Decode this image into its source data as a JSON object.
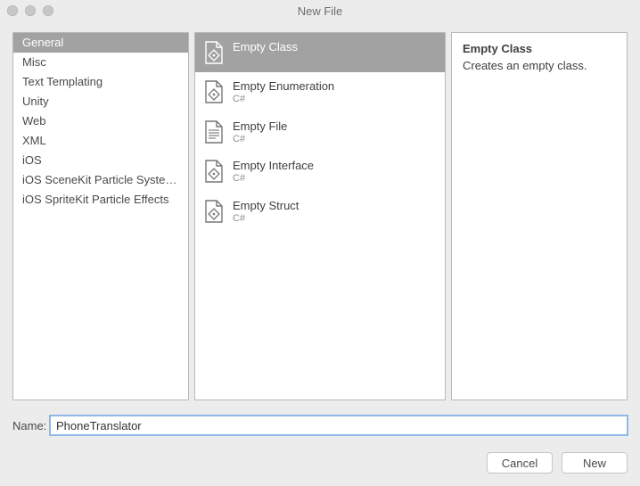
{
  "window": {
    "title": "New File"
  },
  "categories": [
    {
      "label": "General",
      "selected": true
    },
    {
      "label": "Misc",
      "selected": false
    },
    {
      "label": "Text Templating",
      "selected": false
    },
    {
      "label": "Unity",
      "selected": false
    },
    {
      "label": "Web",
      "selected": false
    },
    {
      "label": "XML",
      "selected": false
    },
    {
      "label": "iOS",
      "selected": false
    },
    {
      "label": "iOS SceneKit Particle Systems",
      "selected": false
    },
    {
      "label": "iOS SpriteKit Particle Effects",
      "selected": false
    }
  ],
  "templates": [
    {
      "name": "Empty Class",
      "subtitle": "",
      "selected": true,
      "icon": "class"
    },
    {
      "name": "Empty Enumeration",
      "subtitle": "C#",
      "selected": false,
      "icon": "class"
    },
    {
      "name": "Empty File",
      "subtitle": "C#",
      "selected": false,
      "icon": "file"
    },
    {
      "name": "Empty Interface",
      "subtitle": "C#",
      "selected": false,
      "icon": "class"
    },
    {
      "name": "Empty Struct",
      "subtitle": "C#",
      "selected": false,
      "icon": "class"
    }
  ],
  "description": {
    "title": "Empty Class",
    "text": "Creates an empty class."
  },
  "nameField": {
    "label": "Name:",
    "value": "PhoneTranslator"
  },
  "buttons": {
    "cancel": "Cancel",
    "new": "New"
  }
}
